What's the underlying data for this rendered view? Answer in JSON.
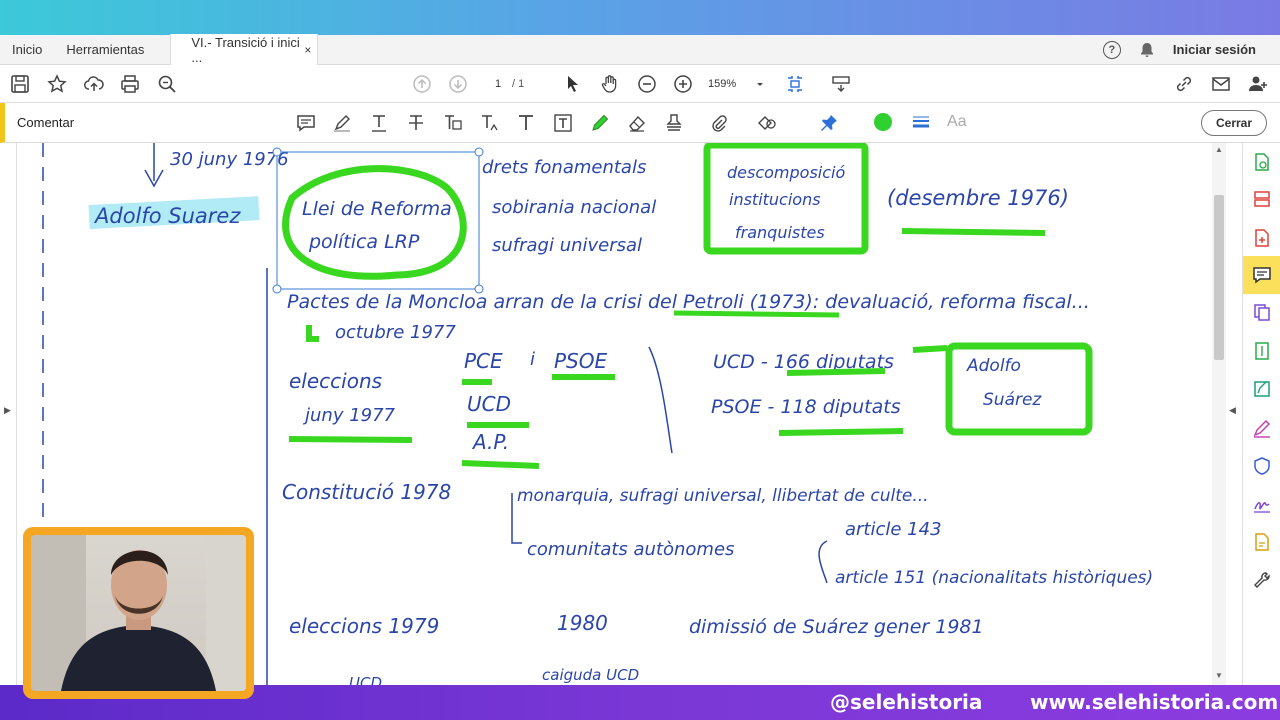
{
  "tabs": {
    "home": "Inicio",
    "tools": "Herramientas",
    "document": "VI.- Transició i inici ...",
    "close": "×"
  },
  "header": {
    "signin": "Iniciar sesión",
    "help": "?"
  },
  "toolbar": {
    "page_current": "1",
    "page_total": "/ 1",
    "zoom": "159%"
  },
  "comment_bar": {
    "label": "Comentar",
    "close_button": "Cerrar",
    "text_size_label": "Aa",
    "color_selected": "#2fd02f"
  },
  "notes": {
    "line_top": "30 juny 1976",
    "adolfo": "Adolfo Suarez",
    "llei_1": "Llei de Reforma",
    "llei_2": "política LRP",
    "drets": "drets fonamentals",
    "sobirania": "sobirania nacional",
    "sufragi": "sufragi universal",
    "descomp_1": "descomposició",
    "descomp_2": "institucions",
    "descomp_3": "franquistes",
    "desembre": "(desembre 1976)",
    "pactes": "Pactes de la Moncloa arran de la crisi del Petroli (1973): devaluació, reforma fiscal...",
    "octubre": "octubre 1977",
    "eleccions": "eleccions",
    "juny77": "juny 1977",
    "pce": "PCE",
    "i": "i",
    "psoe": "PSOE",
    "ucd": "UCD",
    "ap": "A.P.",
    "ucd_result": "UCD - 166 diputats",
    "psoe_result": "PSOE - 118 diputats",
    "adolfo_box_1": "Adolfo",
    "adolfo_box_2": "Suárez",
    "constitucio": "Constitució 1978",
    "monarquia": "monarquia, sufragi universal, llibertat de culte...",
    "comunitats": "comunitats autònomes",
    "article143": "article 143",
    "article151": "article 151 (nacionalitats històriques)",
    "eleccions79": "eleccions 1979",
    "year80": "1980",
    "dimissio": "dimissió de Suárez gener 1981",
    "caiguda": "caiguda UCD",
    "ucd_bottom": "UCD"
  },
  "watermark": {
    "handle": "@selehistoria",
    "site": "www.selehistoria.com"
  }
}
